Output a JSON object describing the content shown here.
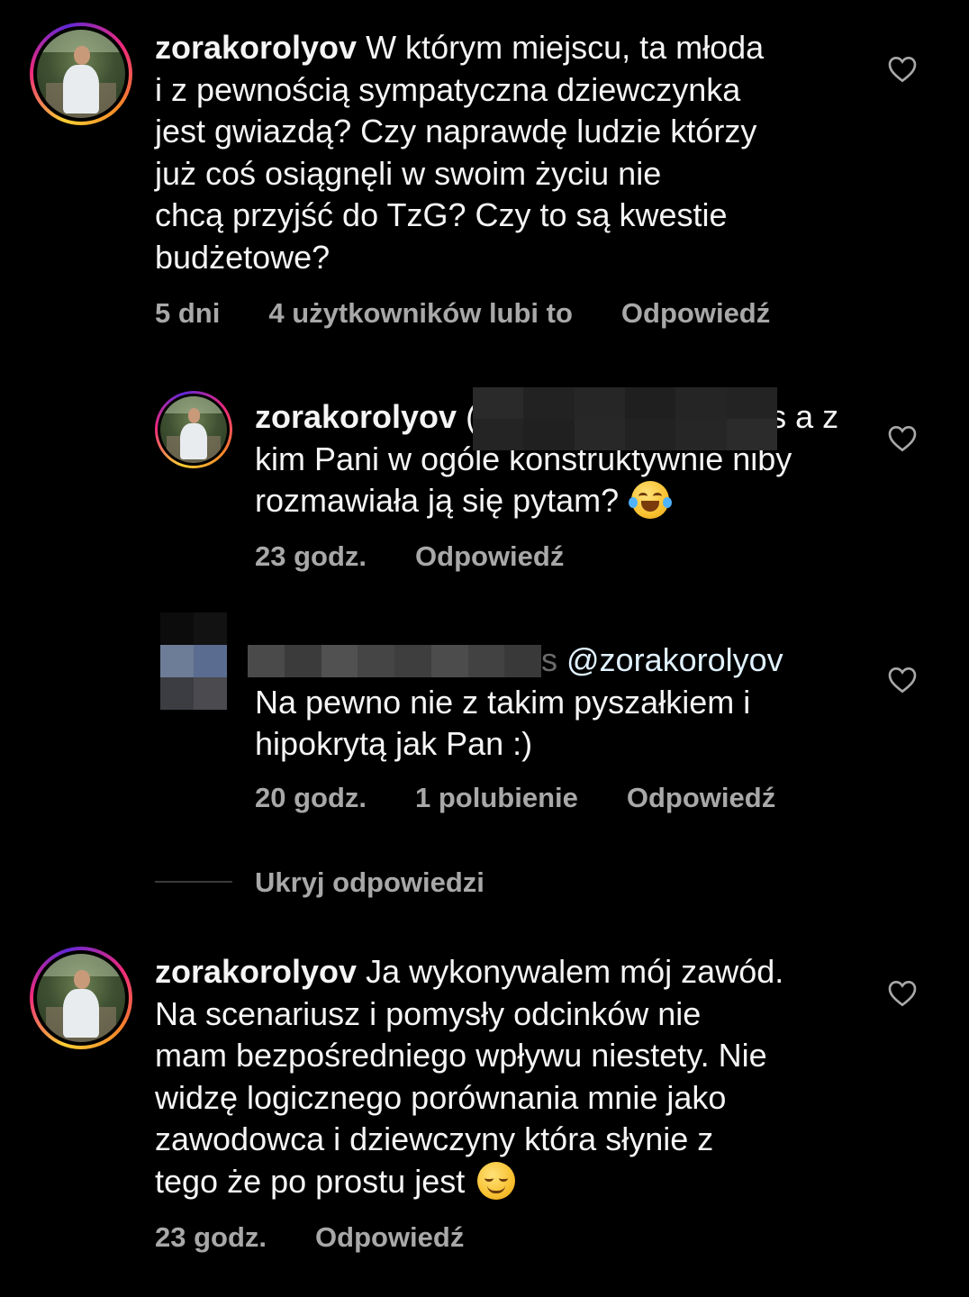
{
  "comments": [
    {
      "username": "zorakorolyov",
      "text": " W którym miejscu, ta młoda\ni z pewnością sympatyczna dziewczynka\njest gwiazdą? Czy naprawdę ludzie którzy\njuż coś osiągnęli w swoim życiu nie\nchcą przyjść do TzG? Czy to są kwestie\nbudżetowe?",
      "time": "5 dni",
      "likes": "4 użytkowników lubi to",
      "reply": "Odpowiedź"
    },
    {
      "username": "zorakorolyov",
      "mention_visible": " (",
      "mention_tail": "s a z",
      "text": "kim Pani w ogóle konstruktywnie niby\nrozmawiała ją się pytam?",
      "emoji": "face-with-tears-of-joy",
      "time": "23 godz.",
      "reply": "Odpowiedź"
    },
    {
      "username_hidden": true,
      "mention_tail": "s",
      "mention": "@zorakorolyov",
      "text": "Na pewno nie z takim pyszałkiem i\nhipokrytą jak Pan :)",
      "time": "20 godz.",
      "likes": "1 polubienie",
      "reply": "Odpowiedź"
    },
    {
      "username": "zorakorolyov",
      "text": " Ja wykonywalem mój zawód.\nNa scenariusz i pomysły odcinków nie\nmam bezpośredniego wpływu niestety. Nie\nwidzę logicznego porównania mnie jako\nzawodowca i dziewczyny która słynie z\ntego że po prostu jest",
      "emoji": "relieved-face",
      "time": "23 godz.",
      "reply": "Odpowiedź"
    }
  ],
  "hide_replies": "Ukryj odpowiedzi",
  "icons": {
    "like": "heart-outline-icon"
  },
  "colors": {
    "background": "#000000",
    "text": "#f5f5f5",
    "meta": "#a8a8a8",
    "divider": "#3a3a3a"
  }
}
